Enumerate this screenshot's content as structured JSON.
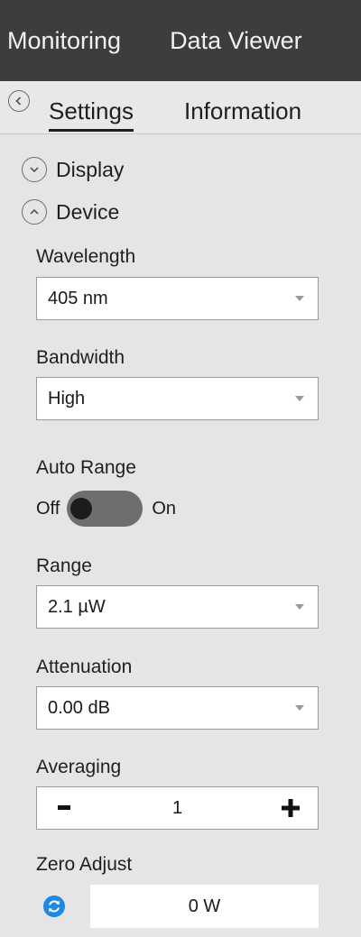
{
  "topbar": {
    "tabs": [
      "Monitoring",
      "Data Viewer"
    ]
  },
  "tabs": {
    "settings": "Settings",
    "information": "Information"
  },
  "sections": {
    "display": "Display",
    "device": "Device"
  },
  "fields": {
    "wavelength": {
      "label": "Wavelength",
      "value": "405 nm"
    },
    "bandwidth": {
      "label": "Bandwidth",
      "value": "High"
    },
    "auto_range": {
      "label": "Auto Range",
      "off_label": "Off",
      "on_label": "On",
      "state": "off"
    },
    "range": {
      "label": "Range",
      "value": "2.1 µW"
    },
    "attenuation": {
      "label": "Attenuation",
      "value": "0.00 dB"
    },
    "averaging": {
      "label": "Averaging",
      "value": "1"
    },
    "zero_adjust": {
      "label": "Zero Adjust",
      "value": "0 W"
    }
  },
  "colors": {
    "header_bg": "#3d3d3d",
    "panel_bg": "#e5e5e5",
    "accent_refresh": "#1e88e5"
  },
  "icons": {
    "back": "chevron-left-circle-icon",
    "display_toggle": "chevron-down-circle-icon",
    "device_toggle": "chevron-up-circle-icon",
    "dropdown_caret": "caret-down-icon",
    "refresh": "refresh-icon"
  }
}
